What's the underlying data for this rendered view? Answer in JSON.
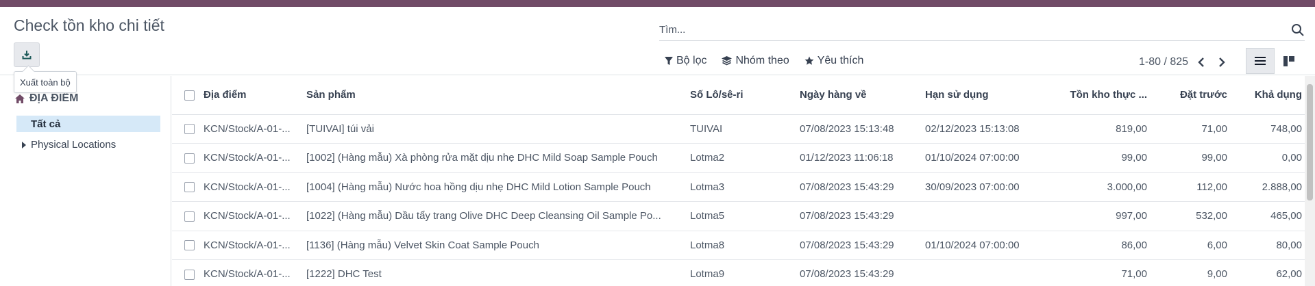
{
  "header": {
    "title": "Check tồn kho chi tiết"
  },
  "export": {
    "tooltip": "Xuất toàn bộ",
    "icon": "download-icon"
  },
  "search": {
    "placeholder": "Tìm..."
  },
  "filters": {
    "filter_label": "Bộ lọc",
    "group_label": "Nhóm theo",
    "favorite_label": "Yêu thích"
  },
  "pager": {
    "text": "1-80 / 825"
  },
  "sidebar": {
    "heading": "ĐỊA ĐIỂM",
    "items": [
      {
        "label": "Tất cả"
      },
      {
        "label": "Physical Locations"
      }
    ]
  },
  "table": {
    "columns": [
      "Địa điểm",
      "Sản phẩm",
      "Số Lô/sê-ri",
      "Ngày hàng về",
      "Hạn sử dụng",
      "Tồn kho thực ...",
      "Đặt trước",
      "Khả dụng"
    ],
    "rows": [
      [
        "KCN/Stock/A-01-...",
        "[TUIVAI] túi vải",
        "TUIVAI",
        "07/08/2023 15:13:48",
        "02/12/2023 15:13:08",
        "819,00",
        "71,00",
        "748,00"
      ],
      [
        "KCN/Stock/A-01-...",
        "[1002] (Hàng mẫu) Xà phòng rửa mặt dịu nhẹ DHC Mild Soap Sample Pouch",
        "Lotma2",
        "01/12/2023 11:06:18",
        "01/10/2024 07:00:00",
        "99,00",
        "99,00",
        "0,00"
      ],
      [
        "KCN/Stock/A-01-...",
        "[1004] (Hàng mẫu) Nước hoa hồng dịu nhẹ DHC Mild Lotion Sample Pouch",
        "Lotma3",
        "07/08/2023 15:43:29",
        "30/09/2023 07:00:00",
        "3.000,00",
        "112,00",
        "2.888,00"
      ],
      [
        "KCN/Stock/A-01-...",
        "[1022] (Hàng mẫu) Dầu tẩy trang Olive DHC Deep Cleansing Oil Sample Po...",
        "Lotma5",
        "07/08/2023 15:43:29",
        "",
        "997,00",
        "532,00",
        "465,00"
      ],
      [
        "KCN/Stock/A-01-...",
        "[1136] (Hàng mẫu) Velvet Skin Coat Sample Pouch",
        "Lotma8",
        "07/08/2023 15:43:29",
        "01/10/2024 07:00:00",
        "86,00",
        "6,00",
        "80,00"
      ],
      [
        "KCN/Stock/A-01-...",
        "[1222] DHC Test",
        "Lotma9",
        "07/08/2023 15:43:29",
        "",
        "71,00",
        "9,00",
        "62,00"
      ]
    ]
  },
  "colors": {
    "brand": "#714b67",
    "selected": "#d6e9f8"
  }
}
